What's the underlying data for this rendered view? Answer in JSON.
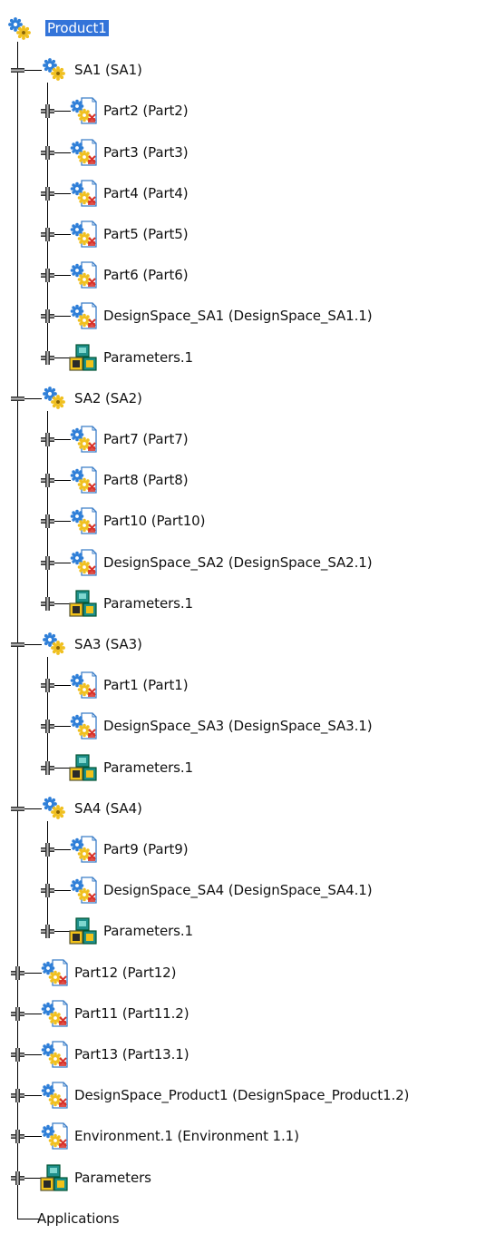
{
  "tree": {
    "root": {
      "label": "Product1",
      "icon": "product-icon",
      "selected": true
    },
    "nodes": [
      {
        "label": "SA1 (SA1)",
        "icon": "product-icon",
        "level": 1,
        "expander": "minus"
      },
      {
        "label": "Part2 (Part2)",
        "icon": "part-icon",
        "level": 2,
        "expander": "plus"
      },
      {
        "label": "Part3 (Part3)",
        "icon": "part-icon",
        "level": 2,
        "expander": "plus"
      },
      {
        "label": "Part4 (Part4)",
        "icon": "part-icon",
        "level": 2,
        "expander": "plus"
      },
      {
        "label": "Part5 (Part5)",
        "icon": "part-icon",
        "level": 2,
        "expander": "plus"
      },
      {
        "label": "Part6 (Part6)",
        "icon": "part-icon",
        "level": 2,
        "expander": "plus"
      },
      {
        "label": "DesignSpace_SA1 (DesignSpace_SA1.1)",
        "icon": "part-icon",
        "level": 2,
        "expander": "plus"
      },
      {
        "label": "Parameters.1",
        "icon": "parameters-icon",
        "level": 2,
        "expander": "plus"
      },
      {
        "label": "SA2 (SA2)",
        "icon": "product-icon",
        "level": 1,
        "expander": "minus"
      },
      {
        "label": "Part7 (Part7)",
        "icon": "part-icon",
        "level": 2,
        "expander": "plus"
      },
      {
        "label": "Part8 (Part8)",
        "icon": "part-icon",
        "level": 2,
        "expander": "plus"
      },
      {
        "label": "Part10 (Part10)",
        "icon": "part-icon",
        "level": 2,
        "expander": "plus"
      },
      {
        "label": "DesignSpace_SA2 (DesignSpace_SA2.1)",
        "icon": "part-icon",
        "level": 2,
        "expander": "plus"
      },
      {
        "label": "Parameters.1",
        "icon": "parameters-icon",
        "level": 2,
        "expander": "plus"
      },
      {
        "label": "SA3 (SA3)",
        "icon": "product-icon",
        "level": 1,
        "expander": "minus"
      },
      {
        "label": "Part1 (Part1)",
        "icon": "part-icon",
        "level": 2,
        "expander": "plus"
      },
      {
        "label": "DesignSpace_SA3 (DesignSpace_SA3.1)",
        "icon": "part-icon",
        "level": 2,
        "expander": "plus"
      },
      {
        "label": "Parameters.1",
        "icon": "parameters-icon",
        "level": 2,
        "expander": "plus"
      },
      {
        "label": "SA4 (SA4)",
        "icon": "product-icon",
        "level": 1,
        "expander": "minus"
      },
      {
        "label": "Part9 (Part9)",
        "icon": "part-icon",
        "level": 2,
        "expander": "plus"
      },
      {
        "label": "DesignSpace_SA4 (DesignSpace_SA4.1)",
        "icon": "part-icon",
        "level": 2,
        "expander": "plus"
      },
      {
        "label": "Parameters.1",
        "icon": "parameters-icon",
        "level": 2,
        "expander": "plus"
      },
      {
        "label": "Part12 (Part12)",
        "icon": "part-icon",
        "level": 1,
        "expander": "plus"
      },
      {
        "label": "Part11 (Part11.2)",
        "icon": "part-icon",
        "level": 1,
        "expander": "plus"
      },
      {
        "label": "Part13 (Part13.1)",
        "icon": "part-icon",
        "level": 1,
        "expander": "plus"
      },
      {
        "label": "DesignSpace_Product1 (DesignSpace_Product1.2)",
        "icon": "part-icon",
        "level": 1,
        "expander": "plus"
      },
      {
        "label": "Environment.1 (Environment 1.1)",
        "icon": "part-icon",
        "level": 1,
        "expander": "plus"
      },
      {
        "label": "Parameters",
        "icon": "parameters-icon",
        "level": 1,
        "expander": "plus"
      },
      {
        "label": "Applications",
        "icon": "",
        "level": 1,
        "expander": "none"
      }
    ]
  },
  "colors": {
    "selection": "#3374d9",
    "gear_blue": "#2f7fd8",
    "gear_yellow": "#f0c020",
    "part_red": "#d8322a",
    "params_teal": "#1e8f8a",
    "params_yellow": "#f2c21a"
  }
}
